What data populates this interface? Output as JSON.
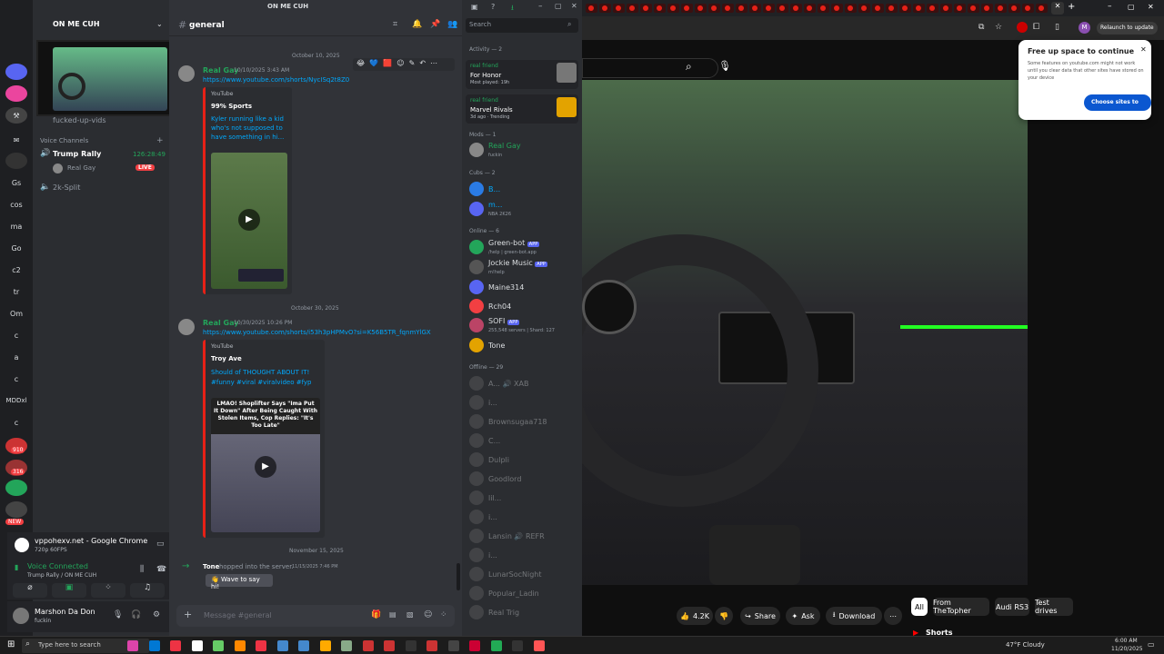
{
  "window": {
    "title": "ON ME CUH"
  },
  "rail": {
    "items": [
      "Gs",
      "cos",
      "ma",
      "Go",
      "c2",
      "tr",
      "Om",
      "c",
      "a",
      "c",
      "MDDxl",
      "c"
    ],
    "badges": [
      "910",
      "316"
    ],
    "new_badge": "NEW"
  },
  "sidebar": {
    "server_name": "ON ME CUH",
    "channel_partial": "fucked-up-vids",
    "voice_header": "Voice Channels",
    "voice_channels": [
      {
        "name": "Trump Rally",
        "timer": "126:28:49"
      },
      {
        "name": "2k-Split"
      }
    ],
    "voice_user": "Real Gay",
    "live": "LIVE",
    "activity_title": "vppohexv.net - Google Chrome",
    "activity_sub": "720p 60FPS",
    "voice_connected": "Voice Connected",
    "voice_location": "Trump Rally / ON ME CUH",
    "user_name": "Marshon Da Don",
    "user_status": "fuckin"
  },
  "chat": {
    "channel": "general",
    "date1": "October 10, 2025",
    "msg1": {
      "author": "Real Gay",
      "time": "10/10/2025 3:43 AM",
      "url": "https://www.youtube.com/shorts/NycISq2t8Z0",
      "embed_provider": "YouTube",
      "embed_author": "99% Sports",
      "embed_title": "Kyler running like a kid who's not supposed to have something in hi..."
    },
    "date2": "October 30, 2025",
    "msg2": {
      "author": "Real Gay",
      "time": "10/30/2025 10:26 PM",
      "url": "https://www.youtube.com/shorts/i53h3pHPMvO?si=K56B5TR_fqnmYlGX",
      "embed_provider": "YouTube",
      "embed_author": "Troy Ave",
      "embed_title": "Should of THOUGHT ABOUT IT! #funny #viral #viralvideo #fyp",
      "thumb_text": "LMAO! Shoplifter Says \"Ima Put It Down\" After Being Caught With Stolen Items, Cop Replies: \"It's Too Late\""
    },
    "date3": "November 15, 2025",
    "join": {
      "author": "Tone",
      "text": "hopped into the server.",
      "time": "11/15/2025 7:46 PM",
      "wave": "Wave to say hi!"
    },
    "input_placeholder": "Message #general"
  },
  "members": {
    "search_placeholder": "Search",
    "activity_header": "Activity — 2",
    "activity": [
      {
        "user": "real friend",
        "game": "For Honor",
        "detail": "Most played: 19h"
      },
      {
        "user": "real friend",
        "game": "Marvel Rivals",
        "detail": "3d ago · Trending"
      }
    ],
    "mods_header": "Mods — 1",
    "mods": [
      {
        "name": "Real Gay",
        "status": "fuckin"
      }
    ],
    "cubs_header": "Cubs — 2",
    "cubs": [
      {
        "name": "B...",
        "status": ""
      },
      {
        "name": "m...",
        "status": "NBA 2K26"
      }
    ],
    "online_header": "Online — 6",
    "online": [
      {
        "name": "Green-bot",
        "tag": "APP",
        "status": "/help | green-bot.app"
      },
      {
        "name": "Jockie Music",
        "tag": "APP",
        "status": "m!help"
      },
      {
        "name": "Maine314",
        "tag": "",
        "status": ""
      },
      {
        "name": "Rch04",
        "tag": "",
        "status": ""
      },
      {
        "name": "SOFI",
        "tag": "APP",
        "status": "255,548 servers | Shard: 127"
      },
      {
        "name": "Tone",
        "tag": "",
        "status": ""
      }
    ],
    "offline_header": "Offline — 29",
    "offline": [
      "A... 🔊 XAB",
      "i...",
      "Brownsugaa718",
      "C...",
      "Dulpli",
      "Goodlord",
      "lil...",
      "i...",
      "Lansin 🔊 REFR",
      "i...",
      "LunarSocNight",
      "Popular_Ladin",
      "Real Trig"
    ]
  },
  "browser": {
    "popup_title": "Free up space to continue",
    "popup_text": "Some features on youtube.com might not work until you clear data that other sites have stored on your device",
    "popup_button": "Choose sites to clear",
    "relaunch": "Relaunch to update",
    "profile": "M",
    "likes": "4.2K",
    "share": "Share",
    "ask": "Ask",
    "download": "Download",
    "chips": [
      "All",
      "From TheTopher",
      "Audi RS3",
      "Test drives"
    ],
    "shorts": "Shorts"
  },
  "taskbar": {
    "search_placeholder": "Type here to search",
    "weather": "47°F Cloudy",
    "time": "6:00 AM",
    "date": "11/20/2025"
  },
  "colors": {
    "accent": "#5865f2",
    "green": "#23a55a",
    "link": "#00a8fc",
    "yt_red": "#e62117"
  }
}
